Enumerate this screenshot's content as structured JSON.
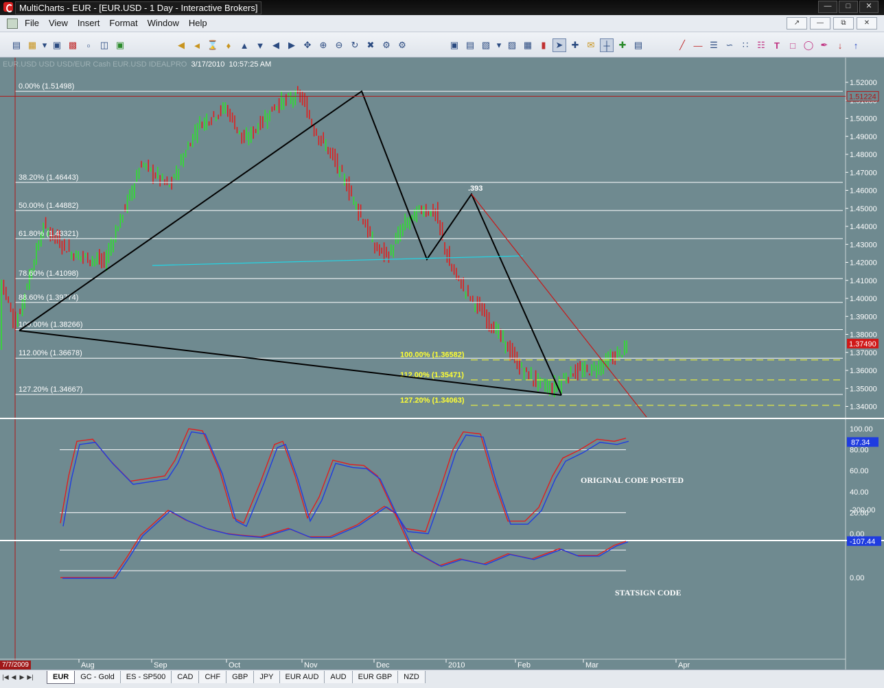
{
  "window": {
    "title": "MultiCharts - EUR - [EUR.USD - 1 Day - Interactive Brokers]"
  },
  "menu": {
    "items": [
      "File",
      "View",
      "Insert",
      "Format",
      "Window",
      "Help"
    ]
  },
  "toolbar": {
    "icons": [
      "new-file",
      "open-folder",
      "dropdown",
      "save",
      "print-setup",
      "properties",
      "workspace",
      "export",
      "scroll-first",
      "scroll-back",
      "hourglass",
      "zoom-fit",
      "arrow-up",
      "arrow-down",
      "prev-bar",
      "next-bar",
      "move-chart",
      "zoom-in",
      "zoom-out",
      "refresh",
      "shrink",
      "settings",
      "chart-window",
      "quote-window",
      "scanner",
      "dropdown2",
      "order-entry",
      "grid",
      "bars",
      "selection-pointer",
      "crosshair",
      "annotation",
      "drawing-cross",
      "insert-indicator",
      "layout",
      "trend-line",
      "horizontal-line",
      "fibonacci-lines",
      "arc",
      "fibonacci-fan",
      "text-tool",
      "rectangle",
      "ellipse",
      "freehand",
      "arrow-down-marker",
      "arrow-up-marker"
    ]
  },
  "symbol_info": {
    "faded": "EUR.USD  USD USD/EUR Cash EUR.USD  IDEALPRO",
    "date": "3/17/2010",
    "time": "10:57:25 AM"
  },
  "price_panel": {
    "fib_levels": [
      {
        "label": "0.00% (1.51498)",
        "price": 1.51498
      },
      {
        "label": "38.20% (1.46443)",
        "price": 1.46443
      },
      {
        "label": "50.00% (1.44882)",
        "price": 1.44882
      },
      {
        "label": "61.80% (1.43321)",
        "price": 1.43321
      },
      {
        "label": "78.60% (1.41098)",
        "price": 1.41098
      },
      {
        "label": "88.60% (1.39774)",
        "price": 1.39774
      },
      {
        "label": "100.00% (1.38266)",
        "price": 1.38266
      },
      {
        "label": "112.00% (1.36678)",
        "price": 1.36678
      },
      {
        "label": "127.20% (1.34667)",
        "price": 1.34667
      }
    ],
    "projection_levels": [
      {
        "label": "100.00% (1.36582)",
        "price": 1.36582
      },
      {
        "label": "112.00% (1.35471)",
        "price": 1.35471
      },
      {
        "label": "127.20% (1.34063)",
        "price": 1.34063
      }
    ],
    "swing_label": ".393",
    "axis_ticks": [
      "1.52000",
      "1.51000",
      "1.50000",
      "1.49000",
      "1.48000",
      "1.47000",
      "1.46000",
      "1.45000",
      "1.44000",
      "1.43000",
      "1.42000",
      "1.41000",
      "1.40000",
      "1.39000",
      "1.38000",
      "1.37000",
      "1.36000",
      "1.35000",
      "1.34000"
    ],
    "tick_values": [
      1.52,
      1.51,
      1.5,
      1.49,
      1.48,
      1.47,
      1.46,
      1.45,
      1.44,
      1.43,
      1.42,
      1.41,
      1.4,
      1.39,
      1.38,
      1.37,
      1.36,
      1.35,
      1.34
    ],
    "current_price_tag": "1.37490",
    "current_price": 1.3749,
    "high_price_tag": "1.51224",
    "high_price": 1.51224
  },
  "stoch_panel": {
    "label": "ORIGINAL CODE POSTED",
    "axis_ticks": [
      "100.00",
      "80.00",
      "60.00",
      "40.00",
      "20.00",
      "0.00"
    ],
    "tick_values": [
      100,
      80,
      60,
      40,
      20,
      0
    ],
    "value_tag": "87.34",
    "value": 87.34
  },
  "stat_panel": {
    "label": "STATSIGN CODE",
    "axis_ticks": [
      "0.00",
      "-200.00"
    ],
    "tick_values": [
      0,
      -200
    ],
    "value_tag": "-107.44",
    "value": -107.44
  },
  "time_axis": {
    "start_flag": "7/7/2009",
    "labels": [
      "Aug",
      "Sep",
      "Oct",
      "Nov",
      "Dec",
      "2010",
      "Feb",
      "Mar",
      "Apr"
    ]
  },
  "tabs": {
    "items": [
      "EUR",
      "GC - Gold",
      "ES - SP500",
      "CAD",
      "CHF",
      "GBP",
      "JPY",
      "EUR AUD",
      "AUD",
      "EUR GBP",
      "NZD"
    ],
    "active": "EUR"
  },
  "colors": {
    "background": "#6f8a90",
    "up_bar": "#2ee02e",
    "down_bar": "#e01e1e",
    "fib_line": "#ffffff",
    "projection": "#ffff33",
    "k_line": "#e01e1e",
    "d_line": "#1f3ce0"
  }
}
